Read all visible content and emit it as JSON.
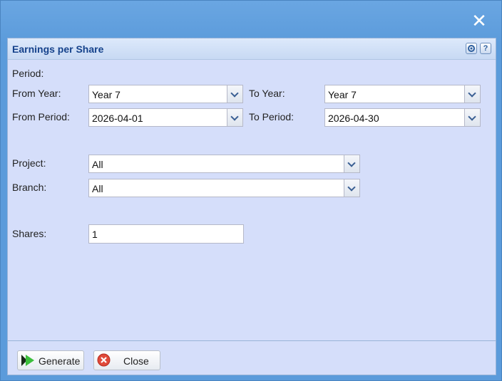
{
  "window": {
    "close_glyph": "✕",
    "panel_title": "Earnings per Share",
    "tools": {
      "gear_icon": "gear-icon",
      "help_glyph": "?"
    }
  },
  "form": {
    "period_label": "Period:",
    "from_year": {
      "label": "From Year:",
      "value": "Year 7"
    },
    "to_year": {
      "label": "To Year:",
      "value": "Year 7"
    },
    "from_period": {
      "label": "From Period:",
      "value": "2026-04-01"
    },
    "to_period": {
      "label": "To Period:",
      "value": "2026-04-30"
    },
    "project": {
      "label": "Project:",
      "value": "All"
    },
    "branch": {
      "label": "Branch:",
      "value": "All"
    },
    "shares": {
      "label": "Shares:",
      "value": "1"
    }
  },
  "footer": {
    "generate_label": "Generate",
    "close_label": "Close"
  },
  "colors": {
    "window_bg": "#5b9bdb",
    "panel_bg": "#d5defa",
    "title_color": "#15428b"
  }
}
